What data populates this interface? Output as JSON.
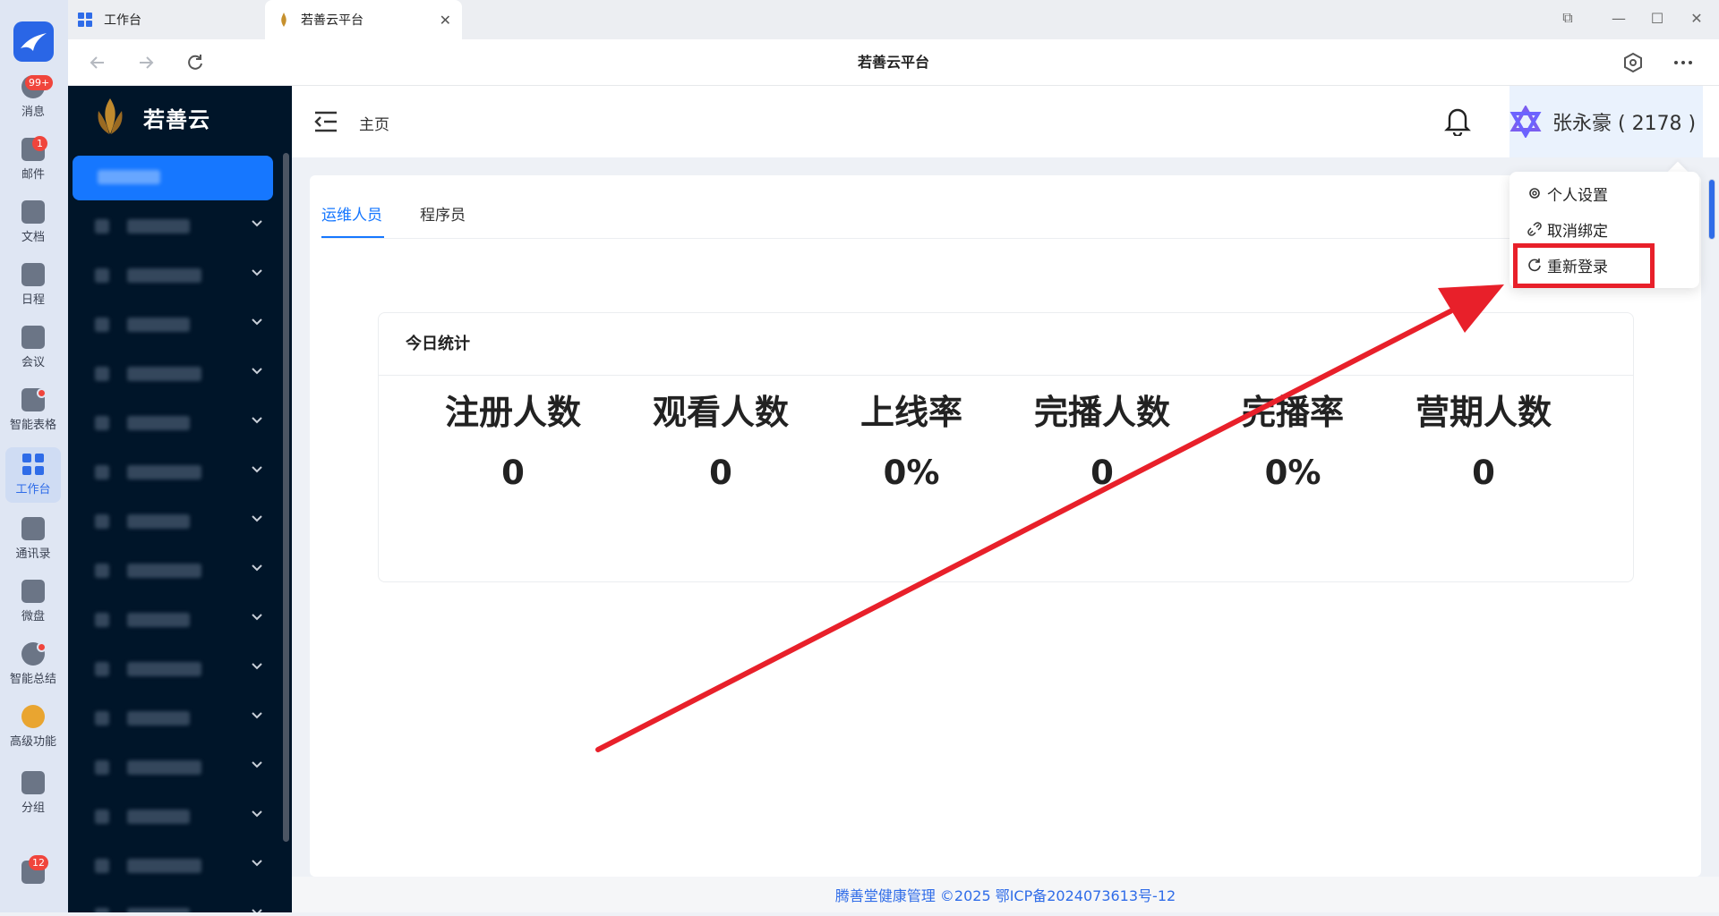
{
  "rail": {
    "items": [
      {
        "label": "消息",
        "badge": "99+"
      },
      {
        "label": "邮件",
        "badge": "1"
      },
      {
        "label": "文档"
      },
      {
        "label": "日程"
      },
      {
        "label": "会议"
      },
      {
        "label": "智能表格",
        "dot": true
      },
      {
        "label": "工作台",
        "active": true
      },
      {
        "label": "通讯录"
      },
      {
        "label": "微盘"
      },
      {
        "label": "智能总结",
        "dot": true
      },
      {
        "label": "高级功能"
      },
      {
        "label": "分组"
      }
    ],
    "bottom_badge": "12"
  },
  "tabs": [
    {
      "label": "工作台"
    },
    {
      "label": "若善云平台",
      "active": true
    }
  ],
  "page_title": "若善云平台",
  "sidebar": {
    "brand": "若善云"
  },
  "header": {
    "breadcrumb": "主页",
    "user_name": "张永豪 ( 2178 )"
  },
  "user_menu": {
    "items": [
      "个人设置",
      "取消绑定",
      "重新登录"
    ]
  },
  "main": {
    "tabs": [
      "运维人员",
      "程序员"
    ],
    "active_tab": "运维人员",
    "card_title": "今日统计",
    "stats": [
      {
        "label": "注册人数",
        "value": "0"
      },
      {
        "label": "观看人数",
        "value": "0"
      },
      {
        "label": "上线率",
        "value": "0%"
      },
      {
        "label": "完播人数",
        "value": "0"
      },
      {
        "label": "完播率",
        "value": "0%"
      },
      {
        "label": "营期人数",
        "value": "0"
      }
    ]
  },
  "footer": "腾善堂健康管理 ©2025 鄂ICP备2024073613号-12",
  "colors": {
    "accent": "#1677ff",
    "sidebar_bg": "#001529",
    "annotation_red": "#e8202a"
  }
}
